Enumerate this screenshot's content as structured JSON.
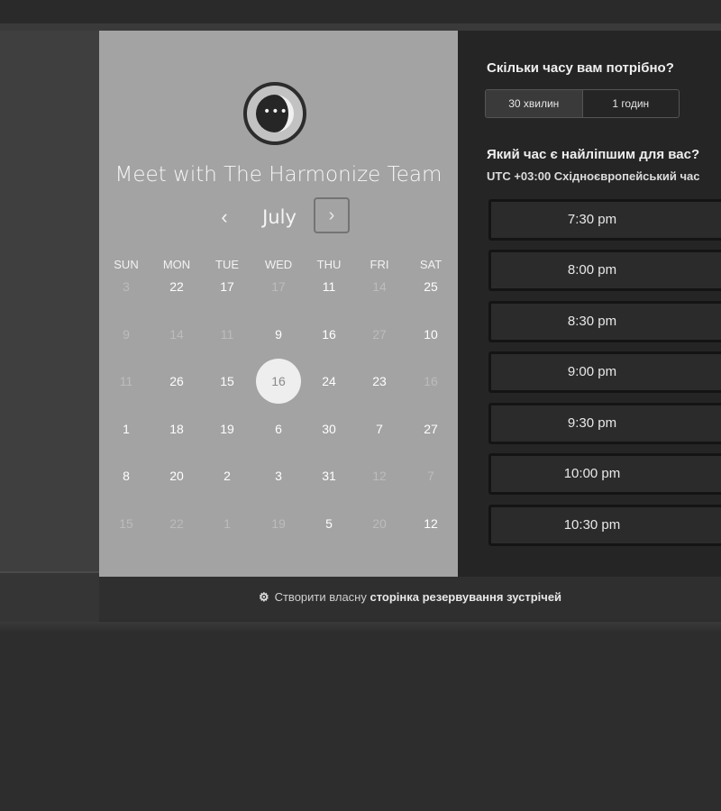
{
  "booking": {
    "title": "Meet with The Harmonize Team",
    "month": "July",
    "prev_symbol": "‹",
    "next_symbol": "›",
    "weekdays": [
      "SUN",
      "MON",
      "TUE",
      "WED",
      "THU",
      "FRI",
      "SAT"
    ],
    "weeks": [
      [
        {
          "d": "3",
          "on": false
        },
        {
          "d": "22",
          "on": true
        },
        {
          "d": "17",
          "on": true
        },
        {
          "d": "17",
          "on": false
        },
        {
          "d": "11",
          "on": true
        },
        {
          "d": "14",
          "on": false
        },
        {
          "d": "25",
          "on": true
        }
      ],
      [
        {
          "d": "9",
          "on": false
        },
        {
          "d": "14",
          "on": false
        },
        {
          "d": "11",
          "on": false
        },
        {
          "d": "9",
          "on": true
        },
        {
          "d": "16",
          "on": true
        },
        {
          "d": "27",
          "on": false
        },
        {
          "d": "10",
          "on": true
        }
      ],
      [
        {
          "d": "11",
          "on": false
        },
        {
          "d": "26",
          "on": true
        },
        {
          "d": "15",
          "on": true
        },
        {
          "d": "16",
          "on": true,
          "selected": true
        },
        {
          "d": "24",
          "on": true
        },
        {
          "d": "23",
          "on": true
        },
        {
          "d": "16",
          "on": false
        }
      ],
      [
        {
          "d": "1",
          "on": true
        },
        {
          "d": "18",
          "on": true
        },
        {
          "d": "19",
          "on": true
        },
        {
          "d": "6",
          "on": true
        },
        {
          "d": "30",
          "on": true
        },
        {
          "d": "7",
          "on": true
        },
        {
          "d": "27",
          "on": true
        }
      ],
      [
        {
          "d": "8",
          "on": true
        },
        {
          "d": "20",
          "on": true
        },
        {
          "d": "2",
          "on": true
        },
        {
          "d": "3",
          "on": true
        },
        {
          "d": "31",
          "on": true
        },
        {
          "d": "12",
          "on": false
        },
        {
          "d": "7",
          "on": false
        }
      ],
      [
        {
          "d": "15",
          "on": false
        },
        {
          "d": "22",
          "on": false
        },
        {
          "d": "1",
          "on": false
        },
        {
          "d": "19",
          "on": false
        },
        {
          "d": "5",
          "on": true
        },
        {
          "d": "20",
          "on": false
        },
        {
          "d": "12",
          "on": true
        }
      ]
    ]
  },
  "timepicker": {
    "duration_question": "Скільки часу вам потрібно?",
    "duration_options": [
      "30 хвилин",
      "1 годин"
    ],
    "time_question": "Який час є найліпшим для вас?",
    "timezone": "UTC +03:00 Східноєвропейський час",
    "slots": [
      "7:30 pm",
      "8:00 pm",
      "8:30 pm",
      "9:00 pm",
      "9:30 pm",
      "10:00 pm",
      "10:30 pm"
    ]
  },
  "footer": {
    "prefix": "Створити власну",
    "link": "сторінка резервування зустрічей"
  }
}
